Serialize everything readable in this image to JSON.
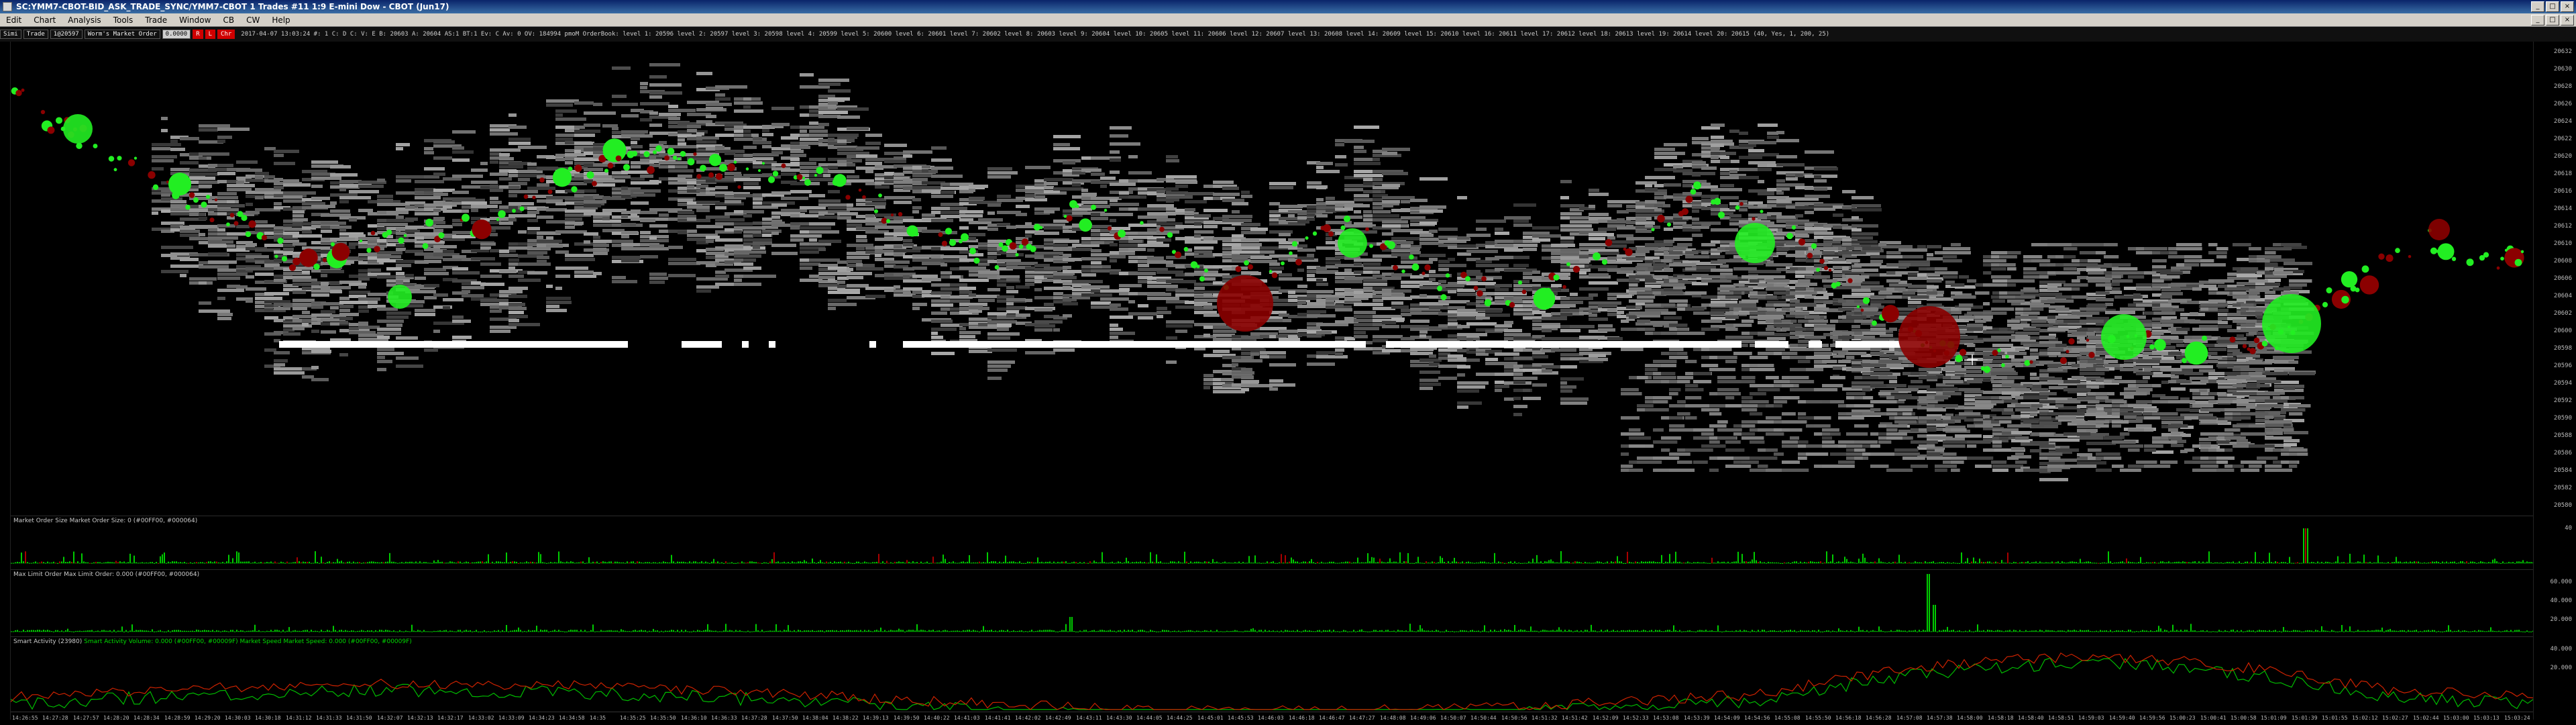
{
  "window": {
    "title": "SC:YMM7-CBOT-BID_ASK_TRADE_SYNC/YMM7-CBOT  1 Trades  #11  1:9  E-mini Dow - CBOT (Jun17)",
    "minimize_label": "_",
    "maximize_label": "□",
    "close_label": "×"
  },
  "menu": {
    "items": [
      "Edit",
      "Chart",
      "Analysis",
      "Tools",
      "Trade",
      "Window",
      "CB",
      "CW",
      "Help"
    ],
    "controls": [
      "_",
      "□",
      "×"
    ]
  },
  "toolbar": {
    "segments": [
      "Simi",
      "Trade",
      "1@20597",
      "Worm's Market Order",
      "0.0000",
      "R",
      "L",
      "Chr"
    ],
    "status": "2017-04-07 13:03:24 #: 1 C: D C: V: E B: 20603 A: 20604 AS:1 BT:1 Ev: C Av: 0 OV: 184994 pmoM OrderBook: level 1: 20596 level 2: 20597 level 3: 20598 level 4: 20599 level 5: 20600 level 6: 20601 level 7: 20602 level 8: 20603 level 9: 20604 level 10: 20605 level 11: 20606 level 12: 20607 level 13: 20608 level 14: 20609 level 15: 20610 level 16: 20611 level 17: 20612 level 18: 20613 level 19: 20614 level 20: 20615  (40, Yes, 1, 200, 25)"
  },
  "price_axis": {
    "labels": [
      "20632",
      "20630",
      "20628",
      "20626",
      "20624",
      "20622",
      "20620",
      "20618",
      "20616",
      "20614",
      "20612",
      "20610",
      "20608",
      "20606",
      "20604",
      "20602",
      "20600",
      "20598",
      "20596",
      "20594",
      "20592",
      "20590",
      "20588",
      "20586",
      "20584",
      "20582",
      "20580"
    ]
  },
  "subgraphs": {
    "market_order_size": {
      "label": "Market Order Size  Market Order Size: 0  (#00FF00, #000064)",
      "axis": [
        "40"
      ]
    },
    "max_limit_order": {
      "label": "Max Limit Order  Max Limit Order: 0.000  (#00FF00, #000064)",
      "axis": [
        "60.000",
        "40.000",
        "20.000"
      ]
    },
    "smart_activity": {
      "label": "Smart Activity (23980)",
      "label_green": "Smart Activity Volume: 0.000  (#00FF00, #00009F)  Market Speed  Market Speed: 0.000  (#00FF00, #00009F)",
      "axis": [
        "40.000",
        "20.000"
      ]
    }
  },
  "time_axis": {
    "labels": [
      "14:26:55",
      "14:27:28",
      "14:27:57",
      "14:28:20",
      "14:28:34",
      "14:28:59",
      "14:29:20",
      "14:30:03",
      "14:30:18",
      "14:31:12",
      "14:31:33",
      "14:31:50",
      "14:32:07",
      "14:32:13",
      "14:32:17",
      "14:33:02",
      "14:33:09",
      "14:34:23",
      "14:34:58",
      "14:35",
      "14:35:25",
      "14:35:50",
      "14:36:10",
      "14:36:33",
      "14:37:28",
      "14:37:50",
      "14:38:04",
      "14:38:22",
      "14:39:13",
      "14:39:50",
      "14:40:22",
      "14:41:03",
      "14:41:41",
      "14:42:02",
      "14:42:49",
      "14:43:11",
      "14:43:30",
      "14:44:05",
      "14:44:25",
      "14:45:01",
      "14:45:53",
      "14:46:03",
      "14:46:18",
      "14:46:47",
      "14:47:27",
      "14:48:08",
      "14:49:06",
      "14:50:07",
      "14:50:44",
      "14:50:56",
      "14:51:32",
      "14:51:42",
      "14:52:09",
      "14:52:33",
      "14:53:08",
      "14:53:39",
      "14:54:09",
      "14:54:56",
      "14:55:08",
      "14:55:50",
      "14:56:18",
      "14:56:28",
      "14:57:08",
      "14:57:38",
      "14:58:00",
      "14:58:18",
      "14:58:40",
      "14:58:51",
      "14:59:03",
      "14:59:40",
      "14:59:56",
      "15:00:23",
      "15:00:41",
      "15:00:58",
      "15:01:09",
      "15:01:39",
      "15:01:55",
      "15:02:12",
      "15:02:27",
      "15:02:44",
      "15:03:00",
      "15:03:13",
      "15:03:24"
    ]
  },
  "colors": {
    "buy_bubble": "#22ee22",
    "sell_bubble": "#8b0000",
    "book_shade": "#9a9a9a",
    "cursor": "#ffffff"
  }
}
